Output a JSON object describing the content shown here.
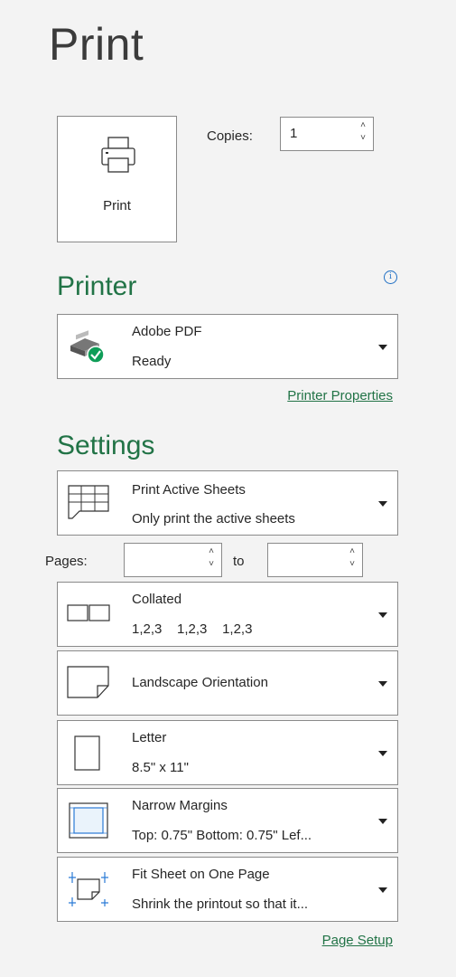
{
  "header": {
    "title": "Print"
  },
  "print_button": {
    "label": "Print",
    "icon": "printer-icon"
  },
  "copies": {
    "label": "Copies:",
    "value": "1"
  },
  "printer": {
    "heading": "Printer",
    "name": "Adobe PDF",
    "status": "Ready",
    "properties_link": "Printer Properties"
  },
  "settings": {
    "heading": "Settings",
    "what": {
      "title": "Print Active Sheets",
      "subtitle": "Only print the active sheets"
    },
    "pages": {
      "label": "Pages:",
      "to_label": "to",
      "from_value": "",
      "to_value": ""
    },
    "collation": {
      "title": "Collated",
      "subtitle": "1,2,3    1,2,3    1,2,3"
    },
    "orientation": {
      "title": "Landscape Orientation"
    },
    "paper": {
      "title": "Letter",
      "subtitle": "8.5\" x 11\""
    },
    "margins": {
      "title": "Narrow Margins",
      "subtitle": "Top: 0.75\" Bottom: 0.75\" Lef..."
    },
    "scaling": {
      "title": "Fit Sheet on One Page",
      "subtitle": "Shrink the printout so that it..."
    },
    "page_setup_link": "Page Setup"
  },
  "colors": {
    "accent": "#217346",
    "link": "#217346",
    "info": "#1f6fc4",
    "status_ok": "#0f9d58"
  }
}
